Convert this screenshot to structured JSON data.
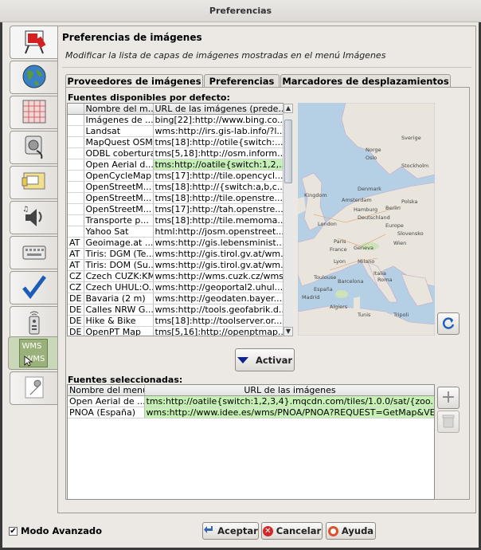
{
  "window": {
    "title": "Preferencias"
  },
  "header": {
    "title": "Preferencias de imágenes",
    "description": "Modificar la lista de capas de imágenes mostradas en el menú Imágenes"
  },
  "sidebar": {
    "items": [
      {
        "name": "display-settings"
      },
      {
        "name": "map-settings"
      },
      {
        "name": "projection-settings"
      },
      {
        "name": "connection-settings"
      },
      {
        "name": "presets-settings"
      },
      {
        "name": "audio-settings"
      },
      {
        "name": "shortcuts-settings"
      },
      {
        "name": "validator-settings"
      },
      {
        "name": "remote-control-settings"
      },
      {
        "name": "wms-settings",
        "label": "WMS"
      },
      {
        "name": "advanced-settings"
      }
    ]
  },
  "tabs": [
    {
      "label": "Proveedores de imágenes"
    },
    {
      "label": "Preferencias"
    },
    {
      "label": "Marcadores de desplazamientos"
    }
  ],
  "available": {
    "label": "Fuentes disponibles por defecto:",
    "columns": [
      "",
      "Nombre del m...",
      "URL de las imágenes (prede..."
    ],
    "rows": [
      {
        "country": "",
        "name": "Imágenes de ...",
        "url": "bing[22]:http://www.bing.co..."
      },
      {
        "country": "",
        "name": "Landsat",
        "url": "wms:http://irs.gis-lab.info/?l..."
      },
      {
        "country": "",
        "name": "MapQuest OSM",
        "url": "tms[18]:http://otile{switch:..."
      },
      {
        "country": "",
        "name": "ODBL cobertura",
        "url": "tms[5,18]:http://osm.inform..."
      },
      {
        "country": "",
        "name": "Open Aerial d...",
        "url": "tms:http://oatile{switch:1,2,..."
      },
      {
        "country": "",
        "name": "OpenCycleMap",
        "url": "tms[17]:http://tile.opencycl..."
      },
      {
        "country": "",
        "name": "OpenStreetM...",
        "url": "tms[18]:http://{switch:a,b,c..."
      },
      {
        "country": "",
        "name": "OpenStreetM...",
        "url": "tms[18]:http://tile.openstre..."
      },
      {
        "country": "",
        "name": "OpenStreetM...",
        "url": "tms[17]:http://tah.openstre..."
      },
      {
        "country": "",
        "name": "Transporte p...",
        "url": "tms[18]:http://tile.memoma..."
      },
      {
        "country": "",
        "name": "Yahoo Sat",
        "url": "html:http://josm.openstreet..."
      },
      {
        "country": "AT",
        "name": "Geoimage.at ...",
        "url": "wms:http://gis.lebensminist..."
      },
      {
        "country": "AT",
        "name": "Tiris: DGM (Te...",
        "url": "wms:http://gis.tirol.gv.at/wm..."
      },
      {
        "country": "AT",
        "name": "Tiris: DOM (Su...",
        "url": "wms:http://gis.tirol.gv.at/wm..."
      },
      {
        "country": "CZ",
        "name": "Czech CUZK:KM",
        "url": "wms:http://wms.cuzk.cz/wms..."
      },
      {
        "country": "CZ",
        "name": "Czech UHUL:O...",
        "url": "wms:http://geoportal2.uhul...."
      },
      {
        "country": "DE",
        "name": "Bavaria (2 m)",
        "url": "wms:http://geodaten.bayer..."
      },
      {
        "country": "DE",
        "name": "Calles NRW G...",
        "url": "wms:http://tools.geofabrik.d..."
      },
      {
        "country": "DE",
        "name": "Hike & Bike",
        "url": "tms[18]:http://toolserver.or..."
      },
      {
        "country": "DE",
        "name": "OpenPT Map",
        "url": "tms[5,16]:http://openptmap..."
      }
    ]
  },
  "map_labels": [
    "Kingdom",
    "Amsterdam",
    "Hamburg",
    "London",
    "Berlin",
    "Deutschland",
    "Paris",
    "France",
    "Wien",
    "Lyon",
    "Milano",
    "Toulouse",
    "Roma",
    "Madrid",
    "Algiers",
    "Tunis",
    "Tripoli",
    "Norge",
    "Sverige",
    "Stockholm",
    "Oslo",
    "Denmark",
    "Polska",
    "Europe",
    "Italia",
    "España",
    "Barcelona",
    "Slovensko",
    "Geneva"
  ],
  "activate_button": {
    "label": "Activar"
  },
  "selected": {
    "label": "Fuentes seleccionadas:",
    "columns": [
      "Nombre del menú",
      "URL de las imágenes"
    ],
    "rows": [
      {
        "name": "Open Aerial de ...",
        "url": "tms:http://oatile{switch:1,2,3,4}.mqcdn.com/tiles/1.0.0/sat/{zoo..."
      },
      {
        "name": "PNOA (España)",
        "url": "wms:http://www.idee.es/wms/PNOA/PNOA?REQUEST=GetMap&VER..."
      }
    ]
  },
  "footer": {
    "advanced_mode_label": "Modo Avanzado",
    "advanced_mode_checked": true,
    "ok_label": "Aceptar",
    "cancel_label": "Cancelar",
    "help_label": "Ayuda"
  }
}
